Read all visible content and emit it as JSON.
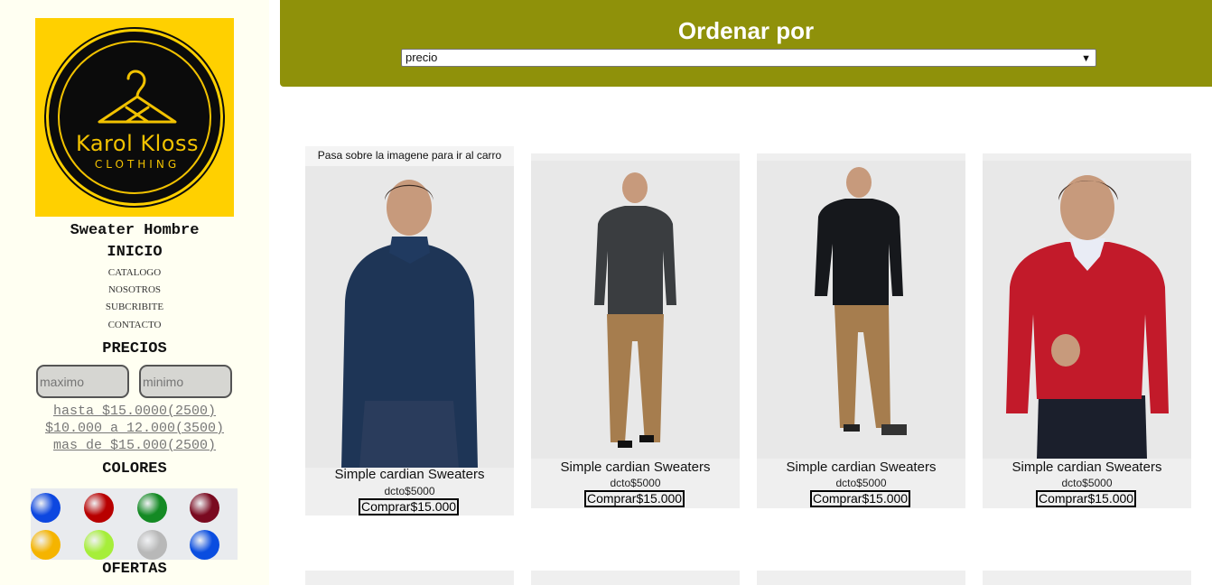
{
  "brand": {
    "name": "Karol Kloss",
    "tagline": "CLOTHING"
  },
  "sidebar": {
    "page_heading": "Sweater Hombre",
    "home_label": "INICIO",
    "nav": [
      "CATALOGO",
      "NOSOTROS",
      "SUBCRIBITE",
      "CONTACTO"
    ],
    "prices_heading": "PRECIOS",
    "price_max_placeholder": "maximo",
    "price_min_placeholder": "minimo",
    "price_ranges": [
      "hasta $15.0000(2500)",
      "$10.000 a 12.000(3500)",
      "mas de $15.000(2500)"
    ],
    "colors_heading": "COLORES",
    "colors": [
      "#0d47e0",
      "#b80000",
      "#148a24",
      "#7a0a20",
      "#f5b400",
      "#a6ee3a",
      "#b8b8b8",
      "#0a4de0"
    ],
    "offers_heading": "OFERTAS"
  },
  "sort": {
    "title": "Ordenar por",
    "selected": "precio"
  },
  "products": {
    "hint": "Pasa sobre la imagene para ir al carro",
    "items": [
      {
        "name": "Simple cardian Sweaters",
        "discount": "dcto$5000",
        "buy": "Comprar$15.000",
        "sweater_color": "#1e3556"
      },
      {
        "name": "Simple cardian Sweaters",
        "discount": "dcto$5000",
        "buy": "Comprar$15.000",
        "sweater_color": "#3a3d40"
      },
      {
        "name": "Simple cardian Sweaters",
        "discount": "dcto$5000",
        "buy": "Comprar$15.000",
        "sweater_color": "#16181c"
      },
      {
        "name": "Simple cardian Sweaters",
        "discount": "dcto$5000",
        "buy": "Comprar$15.000",
        "sweater_color": "#c21a2a"
      }
    ]
  },
  "colors": {
    "topbar": "#8f910a",
    "logo_bg": "#ffd000",
    "sidebar_bg": "#fffff2"
  }
}
